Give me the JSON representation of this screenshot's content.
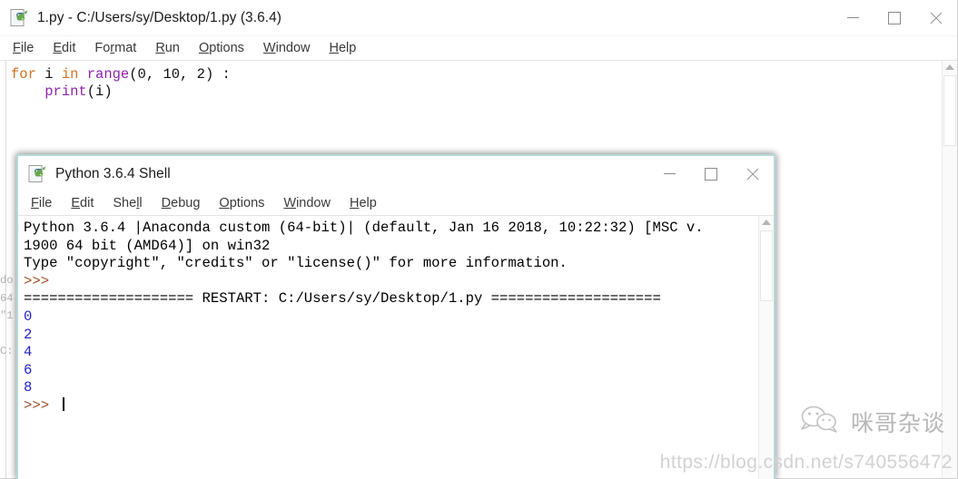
{
  "editor_window": {
    "icon": "python-file-icon",
    "title": "1.py - C:/Users/sy/Desktop/1.py (3.6.4)",
    "menus": [
      {
        "label": "File",
        "accel": "F",
        "rest": "ile"
      },
      {
        "label": "Edit",
        "accel": "E",
        "rest": "dit"
      },
      {
        "label": "Format",
        "pre": "Fo",
        "accel": "r",
        "rest": "mat"
      },
      {
        "label": "Run",
        "accel": "R",
        "rest": "un"
      },
      {
        "label": "Options",
        "accel": "O",
        "rest": "ptions"
      },
      {
        "label": "Window",
        "accel": "W",
        "rest": "indow"
      },
      {
        "label": "Help",
        "accel": "H",
        "rest": "elp"
      }
    ],
    "controls": {
      "minimize": "minimize-icon",
      "maximize": "maximize-icon",
      "close": "close-icon"
    },
    "code": {
      "line1_kw_for": "for",
      "line1_var": " i ",
      "line1_kw_in": "in",
      "line1_fn": " range",
      "line1_args": "(0, 10, 2) :",
      "line2_indent": "    ",
      "line2_fn": "print",
      "line2_args": "(i)"
    },
    "ghost_text": "do\n64\n\"1\n\nC:"
  },
  "shell_window": {
    "icon": "python-file-icon",
    "title": "Python 3.6.4 Shell",
    "menus": [
      {
        "label": "File",
        "accel": "F",
        "rest": "ile"
      },
      {
        "label": "Edit",
        "accel": "E",
        "rest": "dit"
      },
      {
        "label": "Shell",
        "pre": "She",
        "accel": "l",
        "rest": "l"
      },
      {
        "label": "Debug",
        "accel": "D",
        "rest": "ebug"
      },
      {
        "label": "Options",
        "accel": "O",
        "rest": "ptions"
      },
      {
        "label": "Window",
        "accel": "W",
        "rest": "indow"
      },
      {
        "label": "Help",
        "accel": "H",
        "rest": "elp"
      }
    ],
    "controls": {
      "minimize": "minimize-icon",
      "maximize": "maximize-icon",
      "close": "close-icon"
    },
    "banner_line1": "Python 3.6.4 |Anaconda custom (64-bit)| (default, Jan 16 2018, 10:22:32) [MSC v.",
    "banner_line2": "1900 64 bit (AMD64)] on win32",
    "banner_line3": "Type \"copyright\", \"credits\" or \"license()\" for more information.",
    "prompt1": ">>> ",
    "restart_line": "==================== RESTART: C:/Users/sy/Desktop/1.py ====================",
    "output": [
      "0",
      "2",
      "4",
      "6",
      "8"
    ],
    "prompt2": ">>> ",
    "border_color": "#b7d8d8"
  },
  "watermark": {
    "brand_text": "咪哥杂谈",
    "icon": "wechat-chat-icon",
    "url": "https://blog.csdn.net/s740556472"
  },
  "colors": {
    "keyword": "#cf7223",
    "builtin": "#8e24aa",
    "stdout": "#2222c7",
    "prompt": "#a0522d"
  }
}
